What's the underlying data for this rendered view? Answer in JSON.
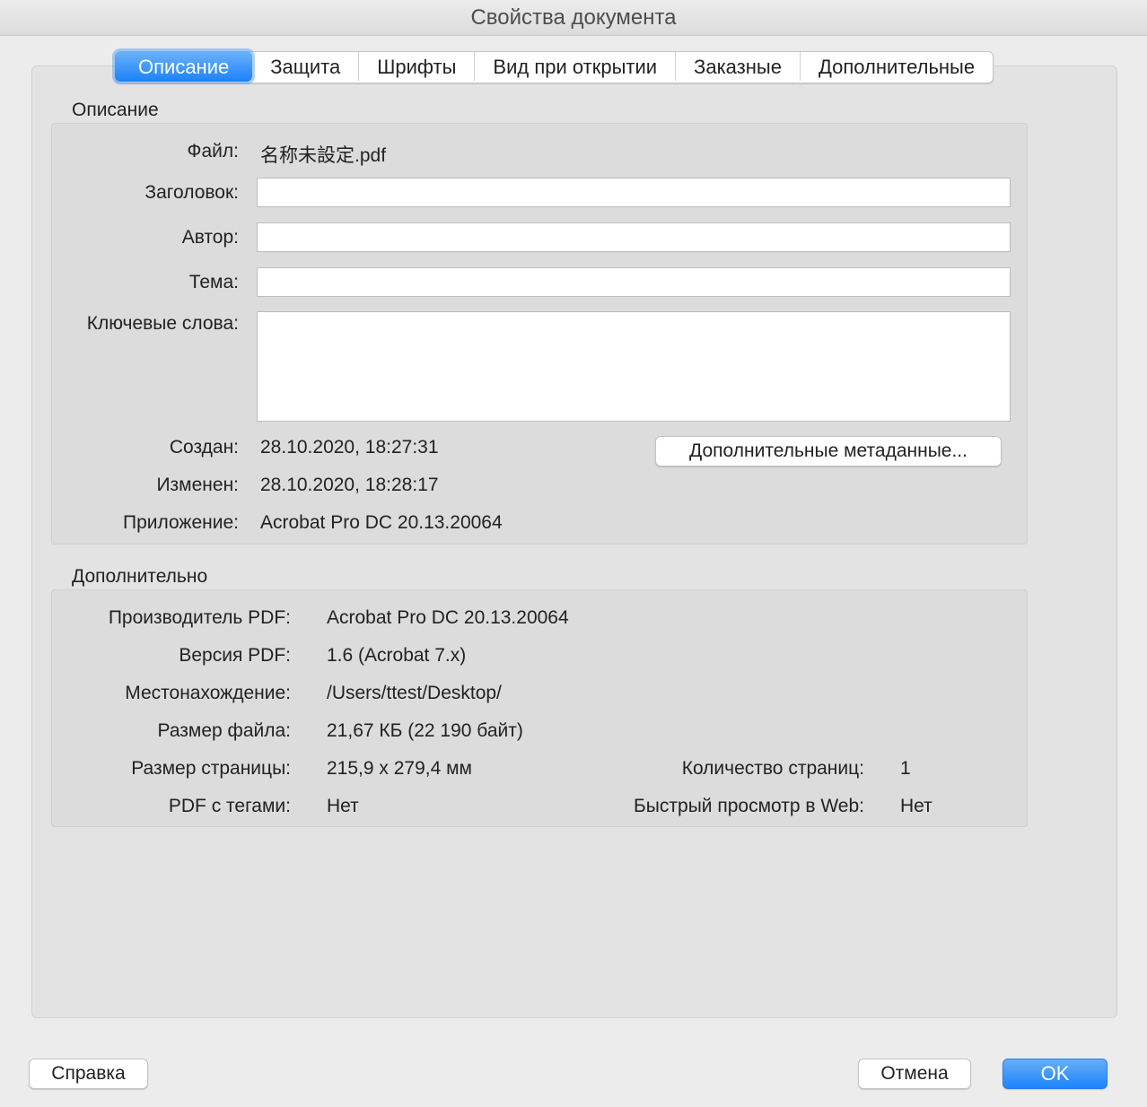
{
  "window": {
    "title": "Свойства документа"
  },
  "tabs": [
    {
      "label": "Описание",
      "active": true
    },
    {
      "label": "Защита"
    },
    {
      "label": "Шрифты"
    },
    {
      "label": "Вид при открытии"
    },
    {
      "label": "Заказные"
    },
    {
      "label": "Дополнительные"
    }
  ],
  "description": {
    "section_title": "Описание",
    "file_label": "Файл:",
    "file_value": "名称未設定.pdf",
    "title_label": "Заголовок:",
    "title_value": "",
    "author_label": "Автор:",
    "author_value": "",
    "subject_label": "Тема:",
    "subject_value": "",
    "keywords_label": "Ключевые слова:",
    "keywords_value": "",
    "created_label": "Создан:",
    "created_value": "28.10.2020, 18:27:31",
    "modified_label": "Изменен:",
    "modified_value": "28.10.2020, 18:28:17",
    "application_label": "Приложение:",
    "application_value": "Acrobat Pro DC 20.13.20064",
    "metadata_button": "Дополнительные метаданные..."
  },
  "advanced": {
    "section_title": "Дополнительно",
    "producer_label": "Производитель PDF:",
    "producer_value": "Acrobat Pro DC 20.13.20064",
    "version_label": "Версия PDF:",
    "version_value": "1.6 (Acrobat 7.x)",
    "location_label": "Местонахождение:",
    "location_value": "/Users/ttest/Desktop/",
    "filesize_label": "Размер файла:",
    "filesize_value": "21,67 КБ (22 190 байт)",
    "pagesize_label": "Размер страницы:",
    "pagesize_value": "215,9 x 279,4 мм",
    "pagecount_label": "Количество страниц:",
    "pagecount_value": "1",
    "tagged_label": "PDF с тегами:",
    "tagged_value": "Нет",
    "fastweb_label": "Быстрый просмотр в Web:",
    "fastweb_value": "Нет"
  },
  "footer": {
    "help_button": "Справка",
    "cancel_button": "Отмена",
    "ok_button": "OK"
  }
}
